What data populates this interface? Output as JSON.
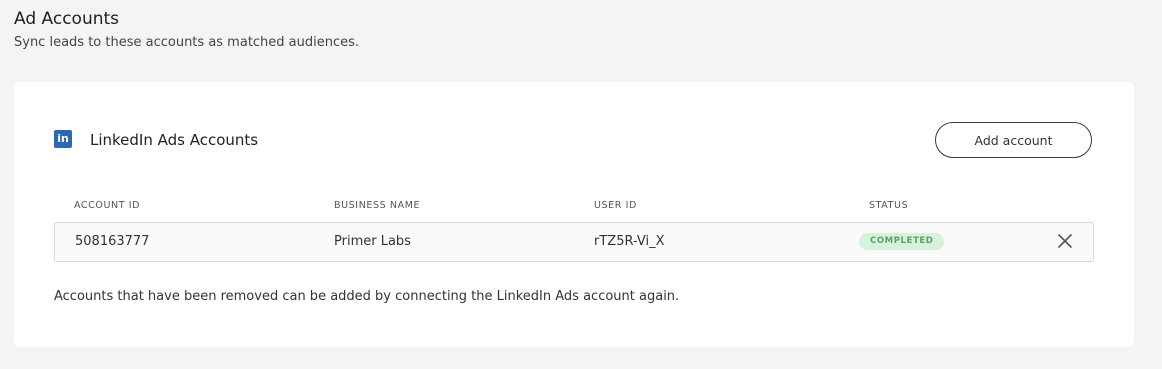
{
  "header": {
    "title": "Ad Accounts",
    "subtitle": "Sync leads to these accounts as matched audiences."
  },
  "card": {
    "icon": "linkedin-icon",
    "icon_glyph": "in",
    "icon_color": "#2f67b0",
    "title": "LinkedIn Ads Accounts",
    "add_button_label": "Add account"
  },
  "table": {
    "columns": [
      "ACCOUNT ID",
      "BUSINESS NAME",
      "USER ID",
      "STATUS"
    ],
    "rows": [
      {
        "account_id": "508163777",
        "business_name": "Primer Labs",
        "user_id": "rTZ5R-Vi_X",
        "status": "COMPLETED",
        "remove_icon": "close-icon"
      }
    ]
  },
  "footer_note": "Accounts that have been removed can be added by connecting the LinkedIn Ads account again.",
  "colors": {
    "status_completed_bg": "#d6f2da",
    "status_completed_text": "#5b9f69"
  }
}
